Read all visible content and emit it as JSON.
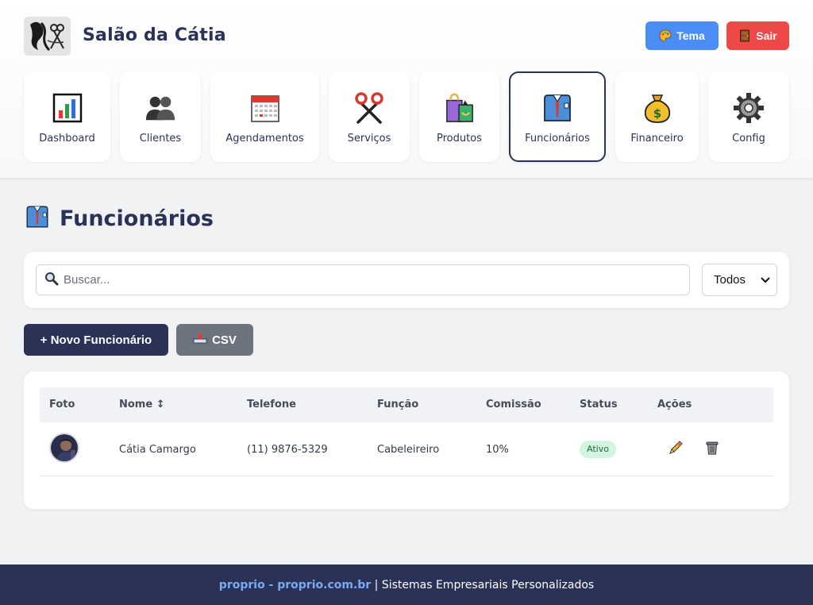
{
  "app": {
    "title": "Salão da Cátia"
  },
  "header": {
    "theme_label": "Tema",
    "exit_label": "Sair"
  },
  "nav": [
    {
      "label": "Dashboard",
      "icon": "bar-chart-icon"
    },
    {
      "label": "Clientes",
      "icon": "people-icon"
    },
    {
      "label": "Agendamentos",
      "icon": "calendar-icon"
    },
    {
      "label": "Serviços",
      "icon": "scissors-icon"
    },
    {
      "label": "Produtos",
      "icon": "shopping-bags-icon"
    },
    {
      "label": "Funcionários",
      "icon": "shirt-tie-icon",
      "active": true
    },
    {
      "label": "Financeiro",
      "icon": "money-bag-icon"
    },
    {
      "label": "Config",
      "icon": "gear-icon"
    }
  ],
  "page": {
    "title": "Funcionários"
  },
  "search": {
    "placeholder": "Buscar..."
  },
  "filter": {
    "selected": "Todos"
  },
  "actions": {
    "new_label": "+ Novo Funcionário",
    "csv_label": "CSV"
  },
  "table": {
    "headers": {
      "foto": "Foto",
      "nome": "Nome ↕",
      "telefone": "Telefone",
      "funcao": "Função",
      "comissao": "Comissão",
      "status": "Status",
      "acoes": "Ações"
    },
    "rows": [
      {
        "nome": "Cátia Camargo",
        "telefone": "(11) 9876-5329",
        "funcao": "Cabeleireiro",
        "comissao": "10%",
        "status": "Ativo"
      }
    ]
  },
  "footer": {
    "link_text": "proprio - proprio.com.br",
    "separator": " | ",
    "tagline": "Sistemas Empresariais Personalizados"
  },
  "colors": {
    "primary": "#2b3257",
    "theme_button": "#4a8df6",
    "exit_button": "#ef4848",
    "csv_button": "#6c7480",
    "active_badge_bg": "#d3f5df"
  }
}
